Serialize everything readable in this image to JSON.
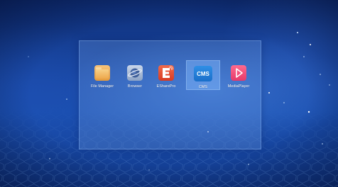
{
  "desktop": {
    "background": "blue-hexagon-wallpaper"
  },
  "launcher": {
    "apps": [
      {
        "label": "File Manager",
        "icon": "folder-icon",
        "color": "#f0aa4f"
      },
      {
        "label": "Browser",
        "icon": "planet-icon",
        "color": "#8ea4c6"
      },
      {
        "label": "ESharePro",
        "icon": "eshare-icon",
        "color": "#e04a2e"
      },
      {
        "label": "CMS",
        "icon": "cms-icon",
        "color": "#2a86de",
        "selected": true,
        "icon_text": "CMS"
      },
      {
        "label": "MediaPlayer",
        "icon": "play-icon",
        "color": "#f05078"
      }
    ]
  }
}
